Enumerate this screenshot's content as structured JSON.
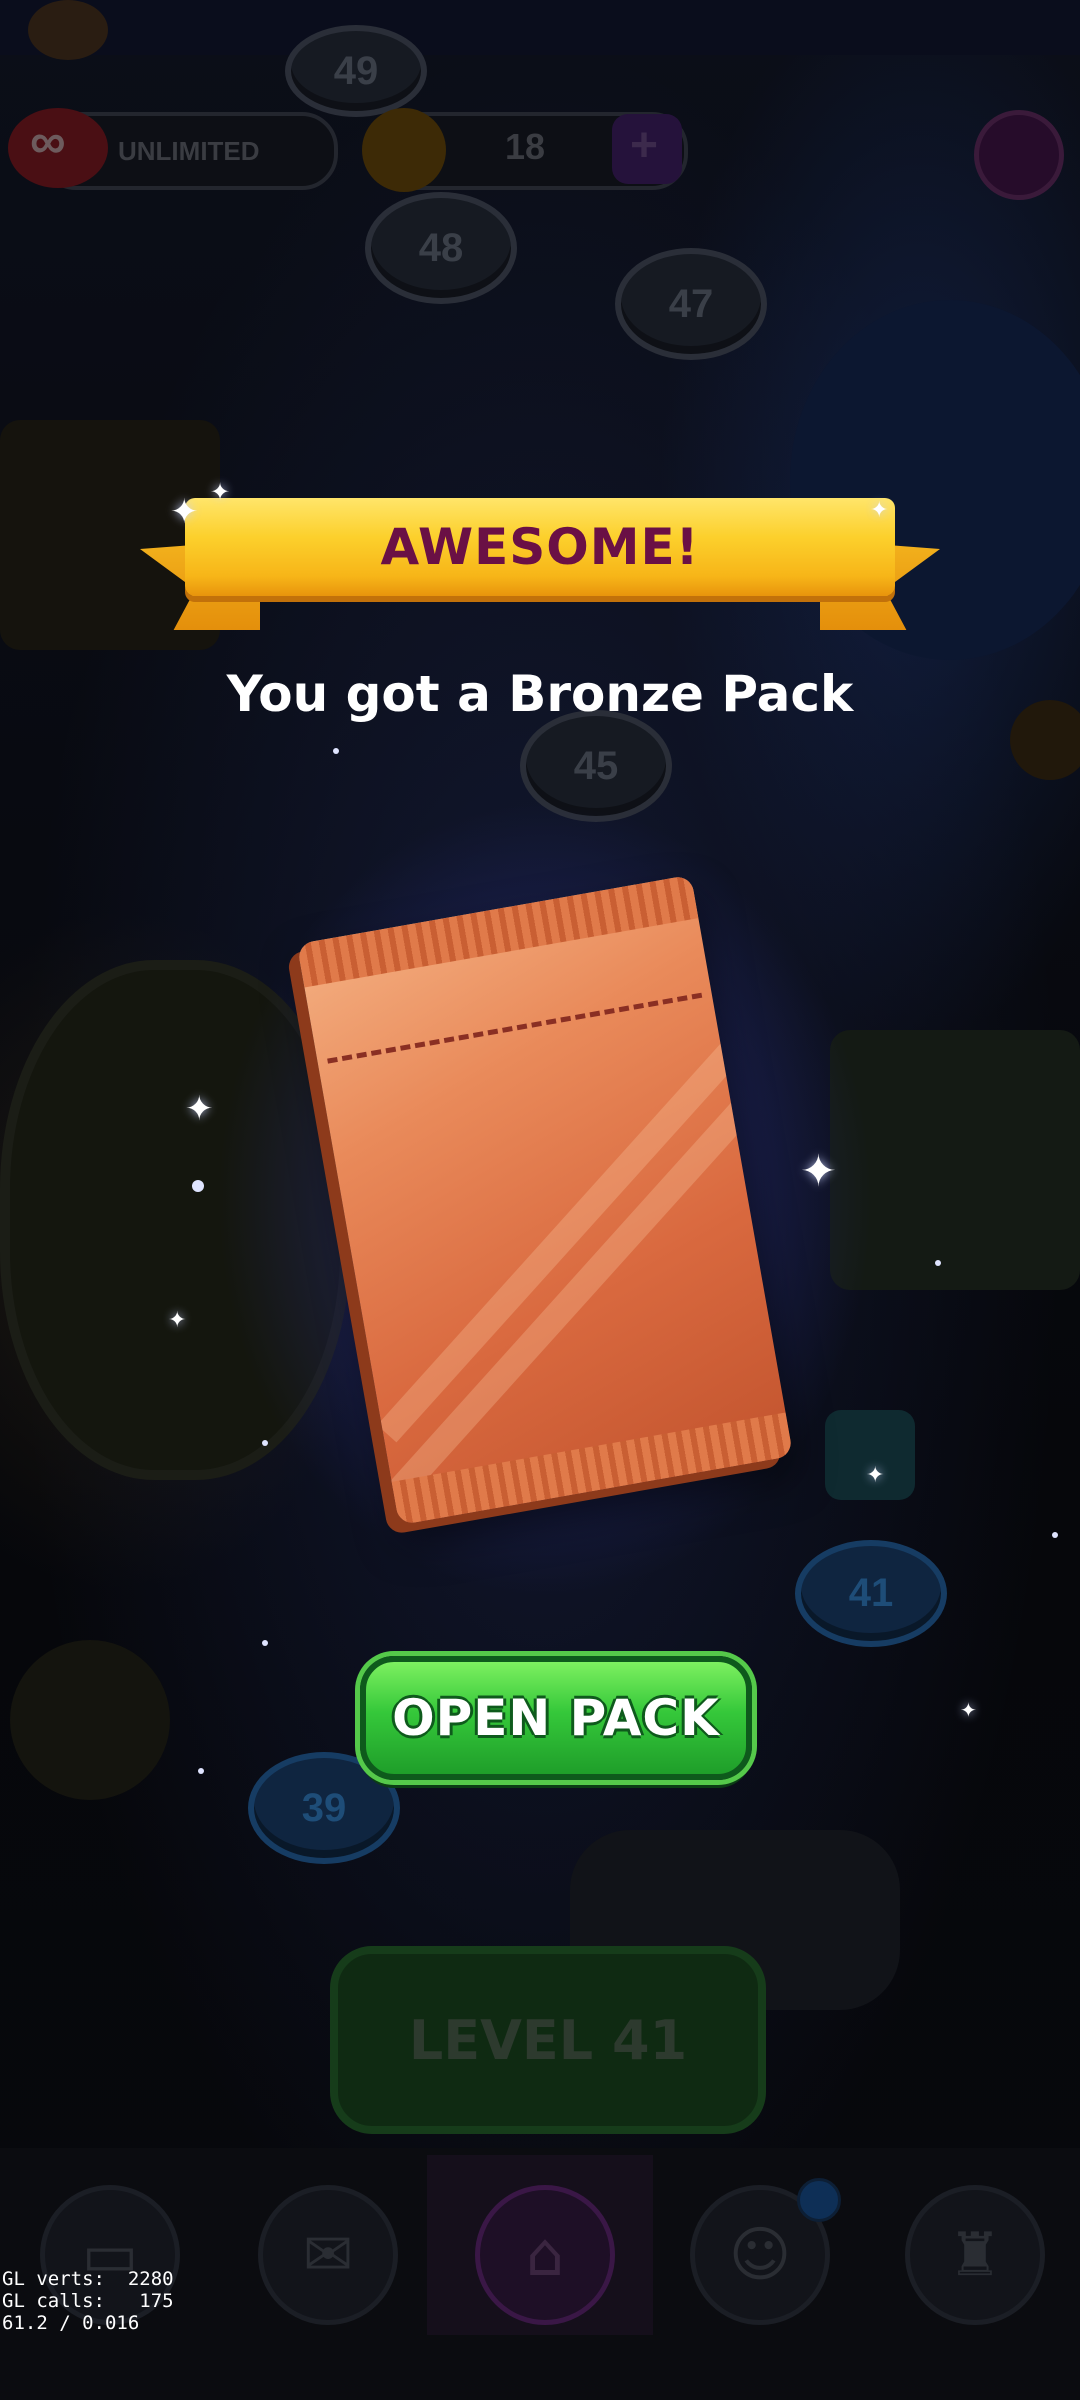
{
  "hud": {
    "lives_label": "UNLIMITED",
    "coins_count": "18",
    "add_symbol": "+",
    "infinity_symbol": "∞"
  },
  "map_nodes": [
    "49",
    "48",
    "47",
    "45",
    "41",
    "39"
  ],
  "reward": {
    "banner_text": "AWESOME!",
    "message": "You got a Bronze Pack",
    "open_button_label": "OPEN PACK"
  },
  "level_button_label": "LEVEL 41",
  "bottom_nav": [
    {
      "name": "cards",
      "icon": "cards-icon"
    },
    {
      "name": "mail",
      "icon": "mail-icon"
    },
    {
      "name": "home",
      "icon": "home-icon"
    },
    {
      "name": "team",
      "icon": "team-icon"
    },
    {
      "name": "trophy",
      "icon": "trophy-icon"
    }
  ],
  "debug": {
    "line1": "GL verts:  2280",
    "line2": "GL calls:   175",
    "line3": "61.2 / 0.016"
  },
  "colors": {
    "banner_gold": "#fcd02c",
    "banner_text": "#6a1045",
    "button_green": "#35c83a",
    "pack_bronze": "#e98a5a"
  }
}
